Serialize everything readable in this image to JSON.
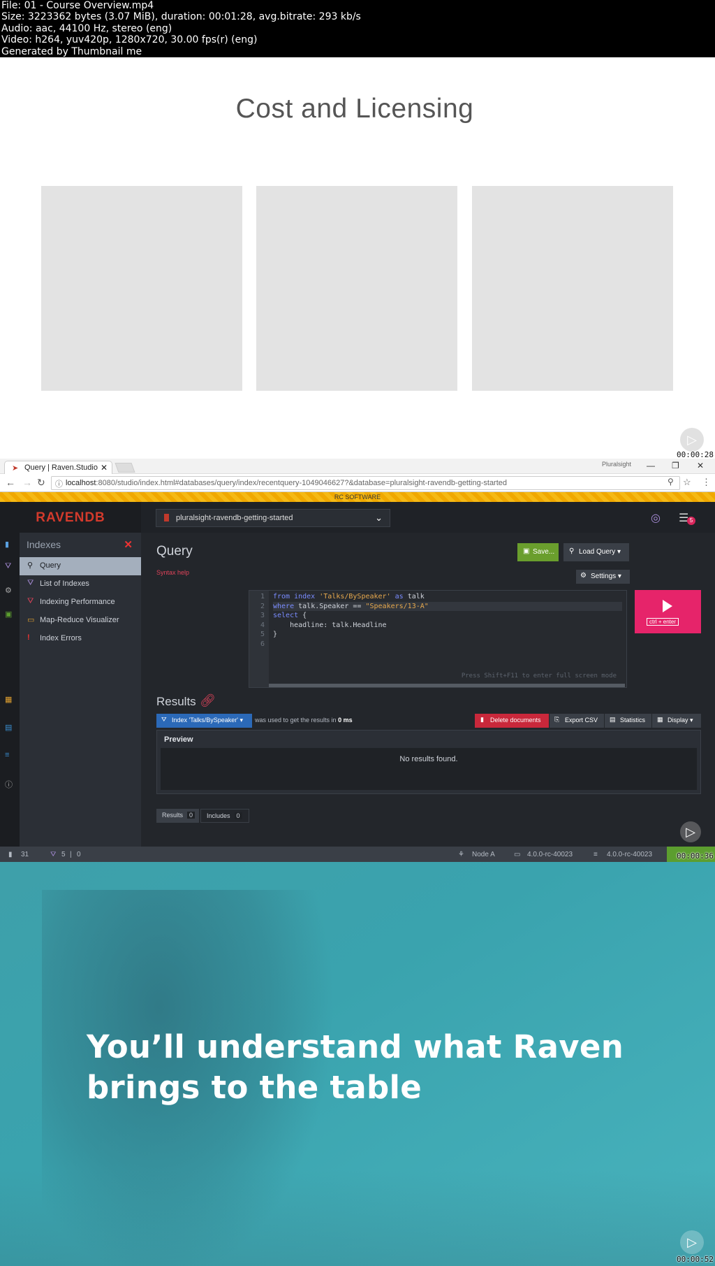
{
  "meta": {
    "lines": [
      "File: 01 - Course Overview.mp4",
      "Size: 3223362 bytes (3.07 MiB), duration: 00:01:28, avg.bitrate: 293 kb/s",
      "Audio: aac, 44100 Hz, stereo (eng)",
      "Video: h264, yuv420p, 1280x720, 30.00 fps(r) (eng)",
      "Generated by Thumbnail me"
    ]
  },
  "frame1": {
    "title": "Cost and Licensing",
    "timestamp": "00:00:28",
    "cards": 3
  },
  "frame2": {
    "tab_title": "Query | Raven.Studio",
    "window_label": "Pluralsight",
    "url_host": "localhost",
    "url_rest": ":8080/studio/index.html#databases/query/index/recentquery-1049046627?&database=pluralsight-ravendb-getting-started",
    "banner": "RC SOFTWARE",
    "logo": "RAVENDB",
    "database": "pluralsight-ravendb-getting-started",
    "notifications": "5",
    "sidebar": {
      "header": "Indexes",
      "items": [
        "Query",
        "List of Indexes",
        "Indexing Performance",
        "Map-Reduce Visualizer",
        "Index Errors"
      ]
    },
    "query": {
      "title": "Query",
      "syntax_help": "Syntax help",
      "save": "Save...",
      "load": "Load Query",
      "settings": "Settings",
      "line_numbers": [
        "1",
        "2",
        "3",
        "4",
        "5",
        "6"
      ],
      "hint": "Press Shift+F11 to enter full screen mode",
      "run_keys": "ctrl + enter"
    },
    "results": {
      "title": "Results",
      "index_label": "Index 'Talks/BySpeaker'",
      "used_text": "was used to get the results in",
      "time": "0 ms",
      "delete": "Delete documents",
      "export": "Export CSV",
      "statistics": "Statistics",
      "display": "Display",
      "preview": "Preview",
      "empty": "No results found.",
      "tab_results": "Results",
      "tab_results_n": "0",
      "tab_includes": "Includes",
      "tab_includes_n": "0"
    },
    "status": {
      "docs": "31",
      "indexes": "5",
      "errors": "0",
      "node": "Node A",
      "client_version": "4.0.0-rc-40023",
      "server_version": "4.0.0-rc-40023"
    },
    "timestamp": "00:00:36"
  },
  "frame3": {
    "tagline_1": "You’ll understand what Raven",
    "tagline_2": "brings to the table",
    "timestamp": "00:00:52"
  },
  "colors": {
    "accent_pink": "#e6246a",
    "save_green": "#6a9e2d",
    "index_blue": "#2b69b8",
    "delete_red": "#c9283b",
    "teal": "#3ea0aa"
  }
}
